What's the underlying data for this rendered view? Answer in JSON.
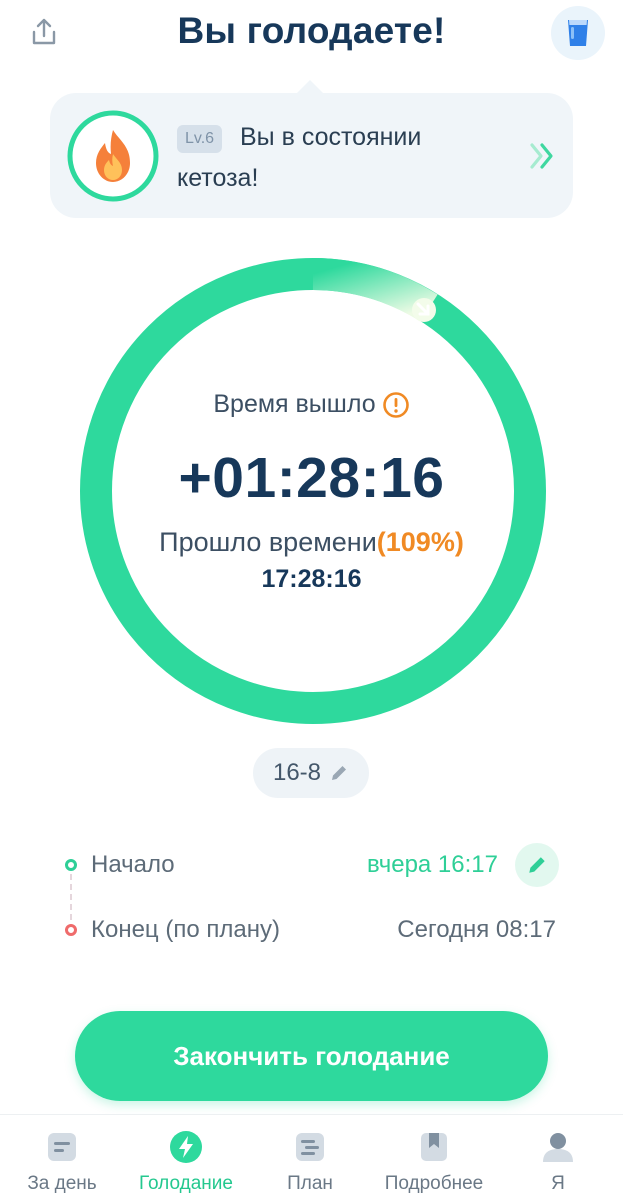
{
  "header": {
    "title": "Вы голодаете!",
    "share_icon": "share-icon",
    "water_icon": "water-glass-icon"
  },
  "status_card": {
    "level": "Lv.6",
    "line1": "Вы в состоянии",
    "line2": "кетоза!",
    "stage_icon": "flame-icon",
    "chevron_icon": "double-chevron-right-icon"
  },
  "timer": {
    "time_up_label": "Время вышло",
    "overtime": "+01:28:16",
    "elapsed_label": "Прошло времени",
    "elapsed_percent": "(109%)",
    "elapsed_time": "17:28:16",
    "progress_percent": 109
  },
  "plan": {
    "label": "16-8"
  },
  "schedule": {
    "start_label": "Начало",
    "start_value": "вчера 16:17",
    "end_label": "Конец (по плану)",
    "end_value": "Сегодня 08:17"
  },
  "actions": {
    "end_fast": "Закончить голодание"
  },
  "tabs": [
    {
      "label": "За день",
      "icon": "day-log-icon",
      "active": false
    },
    {
      "label": "Голодание",
      "icon": "lightning-icon",
      "active": true
    },
    {
      "label": "План",
      "icon": "plan-icon",
      "active": false
    },
    {
      "label": "Подробнее",
      "icon": "bookmark-icon",
      "active": false
    },
    {
      "label": "Я",
      "icon": "profile-icon",
      "active": false
    }
  ],
  "colors": {
    "accent": "#2ed99d",
    "title": "#17385a",
    "warning": "#f08a24",
    "end_dot": "#ef6b6b"
  }
}
